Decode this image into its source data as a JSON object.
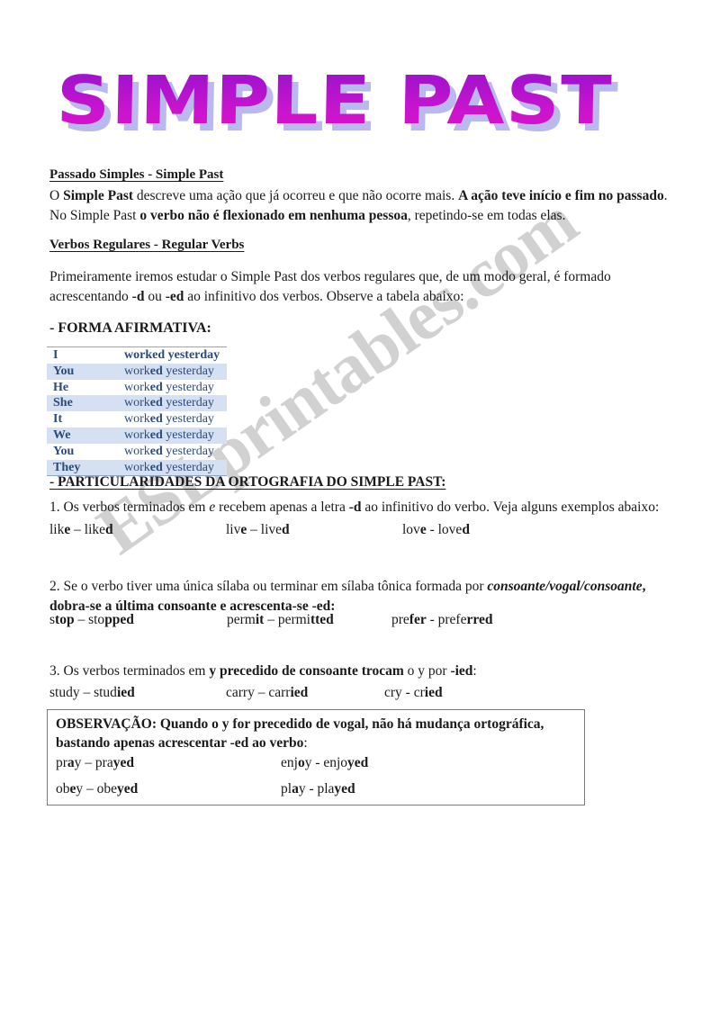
{
  "document": {
    "title_art": "SIMPLE PAST",
    "watermark": "ESLprintables.com",
    "colors": {
      "title_gradient_top": "#9610c9",
      "title_gradient_bottom": "#cc12c2",
      "title_shadow": "#b9b9ee",
      "table_text": "#2c4a7c",
      "table_shade": "#d5e0f2",
      "table_rule": "#8fa6c8",
      "watermark": "#c9c9c9",
      "box_border": "#7a7a7a"
    }
  },
  "sections": {
    "intro": {
      "heading": "Passado Simples - Simple Past",
      "p1_a": "O ",
      "p1_b": "Simple Past",
      "p1_c": " descreve uma ação que já ocorreu e que não ocorre mais. ",
      "p1_d": "A ação teve início e fim no passado",
      "p1_e": ". No Simple Past ",
      "p1_f": "o verbo não é flexionado em nenhuma pessoa",
      "p1_g": ", repetindo-se em todas elas."
    },
    "regular": {
      "heading": "Verbos Regulares - Regular Verbs",
      "p_a": "Primeiramente iremos estudar o Simple Past dos verbos regulares que, de um modo geral, é formado acrescentando ",
      "p_b": "-d",
      "p_c": " ou ",
      "p_d": "-ed",
      "p_e": " ao infinitivo dos verbos. Observe a tabela abaixo:"
    },
    "affirmative": {
      "heading": "- FORMA AFIRMATIVA:",
      "rows": [
        {
          "pronoun": "I",
          "verb_stem": "work",
          "verb_ed": "ed",
          "rest": " yesterday",
          "shaded": false,
          "bold": true
        },
        {
          "pronoun": "You",
          "verb_stem": "work",
          "verb_ed": "ed",
          "rest": " yesterday",
          "shaded": true,
          "bold": false
        },
        {
          "pronoun": "He",
          "verb_stem": "work",
          "verb_ed": "ed",
          "rest": " yesterday",
          "shaded": false,
          "bold": false
        },
        {
          "pronoun": "She",
          "verb_stem": "work",
          "verb_ed": "ed",
          "rest": " yesterday",
          "shaded": true,
          "bold": false
        },
        {
          "pronoun": "It",
          "verb_stem": "work",
          "verb_ed": "ed",
          "rest": " yesterday",
          "shaded": false,
          "bold": false
        },
        {
          "pronoun": "We",
          "verb_stem": "work",
          "verb_ed": "ed",
          "rest": " yesterday",
          "shaded": true,
          "bold": false
        },
        {
          "pronoun": "You",
          "verb_stem": "work",
          "verb_ed": "ed",
          "rest": " yesterday",
          "shaded": false,
          "bold": false
        },
        {
          "pronoun": "They",
          "verb_stem": "work",
          "verb_ed": "ed",
          "rest": " yesterday",
          "shaded": true,
          "bold": false
        }
      ]
    },
    "spelling": {
      "heading": "- PARTICULARIDADES DA ORTOGRAFIA DO SIMPLE PAST:",
      "rule1": {
        "a": "1. Os verbos terminados em ",
        "b": "e",
        "c": " recebem apenas a letra ",
        "d": "-d",
        "e": " ao infinitivo do verbo. Veja alguns exemplos abaixo:",
        "examples": [
          {
            "base_pre": "lik",
            "base_hl": "e",
            "sep": " – ",
            "past_pre": "like",
            "past_hl": "d"
          },
          {
            "base_pre": "liv",
            "base_hl": "e",
            "sep": " – ",
            "past_pre": "live",
            "past_hl": "d"
          },
          {
            "base_pre": "lov",
            "base_hl": "e",
            "sep": " - ",
            "past_pre": "love",
            "past_hl": "d"
          }
        ]
      },
      "rule2": {
        "a": "2. Se o verbo tiver uma única sílaba ou terminar em sílaba tônica formada por ",
        "b": "consoante/vogal/consoante",
        "c": ", ",
        "d": "dobra-se a última consoante e acrescenta-se -ed:",
        "examples": [
          {
            "base_pre": "s",
            "base_hl": "top",
            "sep": " – ",
            "past_pre": "sto",
            "past_hl": "pped"
          },
          {
            "base_pre": "perm",
            "base_hl": "it",
            "sep": " – ",
            "past_pre": "permi",
            "past_hl": "tted"
          },
          {
            "base_pre": "pre",
            "base_hl": "fer",
            "sep": " - ",
            "past_pre": "prefe",
            "past_hl": "rred"
          }
        ]
      },
      "rule3": {
        "a": "3. Os verbos terminados em ",
        "b": "y precedido de consoante trocam",
        "c": " o y por ",
        "d": "-ied",
        "e": ":",
        "examples": [
          {
            "base_pre": "study",
            "base_hl": "",
            "sep": " – ",
            "past_pre": "stud",
            "past_hl": "ied"
          },
          {
            "base_pre": "carry",
            "base_hl": "",
            "sep": " – ",
            "past_pre": "carr",
            "past_hl": "ied"
          },
          {
            "base_pre": "cry",
            "base_hl": "",
            "sep": " - ",
            "past_pre": "cr",
            "past_hl": "ied"
          }
        ]
      }
    },
    "observation": {
      "label": "OBSERVAÇÃO:",
      "body": " Quando o y for precedido de vogal, não há mudança ortográfica, bastando apenas acrescentar -ed ao verbo",
      "tail": ":",
      "examples": [
        [
          {
            "base_pre": "pr",
            "base_hl": "a",
            "base_post": "y",
            "sep": " – ",
            "past_pre": "pra",
            "past_hl": "yed"
          },
          {
            "base_pre": "enj",
            "base_hl": "o",
            "base_post": "y",
            "sep": " - ",
            "past_pre": "enjo",
            "past_hl": "yed"
          }
        ],
        [
          {
            "base_pre": "ob",
            "base_hl": "e",
            "base_post": "y",
            "sep": " – ",
            "past_pre": "obe",
            "past_hl": "yed"
          },
          {
            "base_pre": "pl",
            "base_hl": "a",
            "base_post": "y",
            "sep": " - ",
            "past_pre": "pla",
            "past_hl": "yed"
          }
        ]
      ]
    }
  }
}
